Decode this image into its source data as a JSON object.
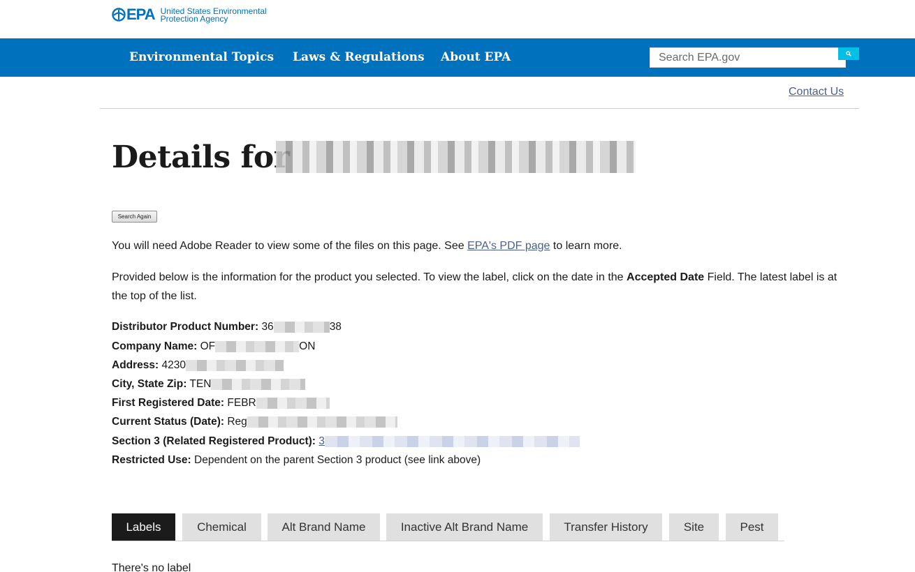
{
  "header": {
    "logo_mark": "EPA",
    "agency_line1": "United States Environmental",
    "agency_line2": "Protection Agency"
  },
  "nav": {
    "items": [
      {
        "label": "Environmental Topics"
      },
      {
        "label": "Laws & Regulations"
      },
      {
        "label": "About EPA"
      }
    ],
    "search_placeholder": "Search EPA.gov"
  },
  "contact_label": "Contact Us",
  "page": {
    "title_prefix": "Details for",
    "search_again_label": "Search Again",
    "pdf_note_before": "You will need Adobe Reader to view some of the files on this page. See ",
    "pdf_link": "EPA's PDF page",
    "pdf_note_after": " to learn more.",
    "info_before": "Provided below is the information for the product you selected. To view the label, click on the date in the ",
    "info_bold": "Accepted Date",
    "info_after": " Field. The latest label is at the top of the list."
  },
  "fields": [
    {
      "label": "Distributor Product Number:",
      "prefix": "36",
      "suffix": "38"
    },
    {
      "label": "Company Name:",
      "prefix": "OF",
      "suffix": "ON"
    },
    {
      "label": "Address:",
      "prefix": "4230",
      "suffix": ""
    },
    {
      "label": "City, State Zip:",
      "prefix": "TEN",
      "suffix": ""
    },
    {
      "label": "First Registered Date:",
      "prefix": "FEBR",
      "suffix": ""
    },
    {
      "label": "Current Status (Date):",
      "prefix": "Reg",
      "suffix": ""
    },
    {
      "label": "Section 3 (Related Registered Product):",
      "prefix": "3",
      "suffix": ""
    },
    {
      "label": "Restricted Use:",
      "value": "Dependent on the parent Section 3 product (see link above)"
    }
  ],
  "tabs": [
    {
      "label": "Labels"
    },
    {
      "label": "Chemical"
    },
    {
      "label": "Alt Brand Name"
    },
    {
      "label": "Inactive Alt Brand Name"
    },
    {
      "label": "Transfer History"
    },
    {
      "label": "Site"
    },
    {
      "label": "Pest"
    }
  ],
  "tab_content": "There's no label",
  "colors": {
    "brand_blue": "#0071bc",
    "search_button": "#02bfe7",
    "link": "#4c5e8c",
    "active_tab": "#1b1b1b",
    "inactive_tab": "#e0e0e0"
  }
}
